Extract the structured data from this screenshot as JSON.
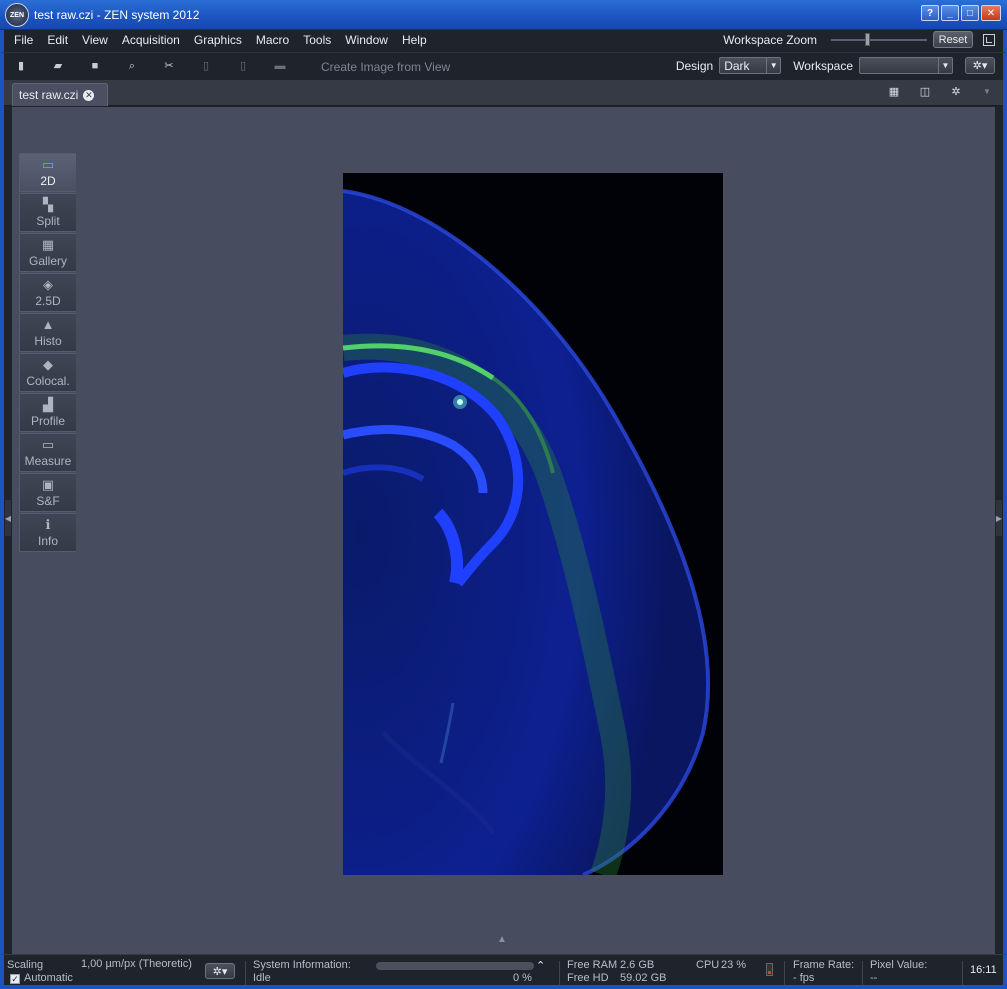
{
  "window": {
    "title": "test raw.czi - ZEN system 2012",
    "logo_text": "ZEN",
    "buttons": [
      "?",
      "_",
      "□",
      "✕"
    ]
  },
  "menu": [
    "File",
    "Edit",
    "View",
    "Acquisition",
    "Graphics",
    "Macro",
    "Tools",
    "Window",
    "Help"
  ],
  "workspace_zoom": {
    "label": "Workspace Zoom",
    "reset_label": "Reset"
  },
  "toolbar": {
    "create_image_label": "Create Image from View",
    "design_label": "Design",
    "design_value": "Dark",
    "workspace_label": "Workspace",
    "workspace_value": ""
  },
  "document": {
    "tab_label": "test raw.czi"
  },
  "view_tabs": [
    {
      "label": "2D",
      "icon": "2d-view-icon",
      "active": true
    },
    {
      "label": "Split",
      "icon": "split-view-icon",
      "active": false
    },
    {
      "label": "Gallery",
      "icon": "gallery-view-icon",
      "active": false
    },
    {
      "label": "2.5D",
      "icon": "2-5d-view-icon",
      "active": false
    },
    {
      "label": "Histo",
      "icon": "histogram-icon",
      "active": false
    },
    {
      "label": "Colocal.",
      "icon": "colocalization-icon",
      "active": false
    },
    {
      "label": "Profile",
      "icon": "profile-icon",
      "active": false
    },
    {
      "label": "Measure",
      "icon": "measure-icon",
      "active": false
    },
    {
      "label": "S&F",
      "icon": "stitch-fuse-icon",
      "active": false
    },
    {
      "label": "Info",
      "icon": "info-icon",
      "active": false
    }
  ],
  "status": {
    "scaling_label": "Scaling",
    "scaling_value": "1,00 µm/px (Theoretic)",
    "automatic_label": "Automatic",
    "system_info_label": "System Information:",
    "system_state": "Idle",
    "progress_percent": "0 %",
    "free_ram_label": "Free RAM",
    "free_ram_value": "2.6 GB",
    "free_hd_label": "Free HD",
    "free_hd_value": "59.02 GB",
    "cpu_label": "CPU",
    "cpu_value": "23 %",
    "frame_rate_label": "Frame Rate:",
    "frame_rate_value": "- fps",
    "pixel_value_label": "Pixel Value:",
    "pixel_value": "--",
    "time": "16:11"
  }
}
